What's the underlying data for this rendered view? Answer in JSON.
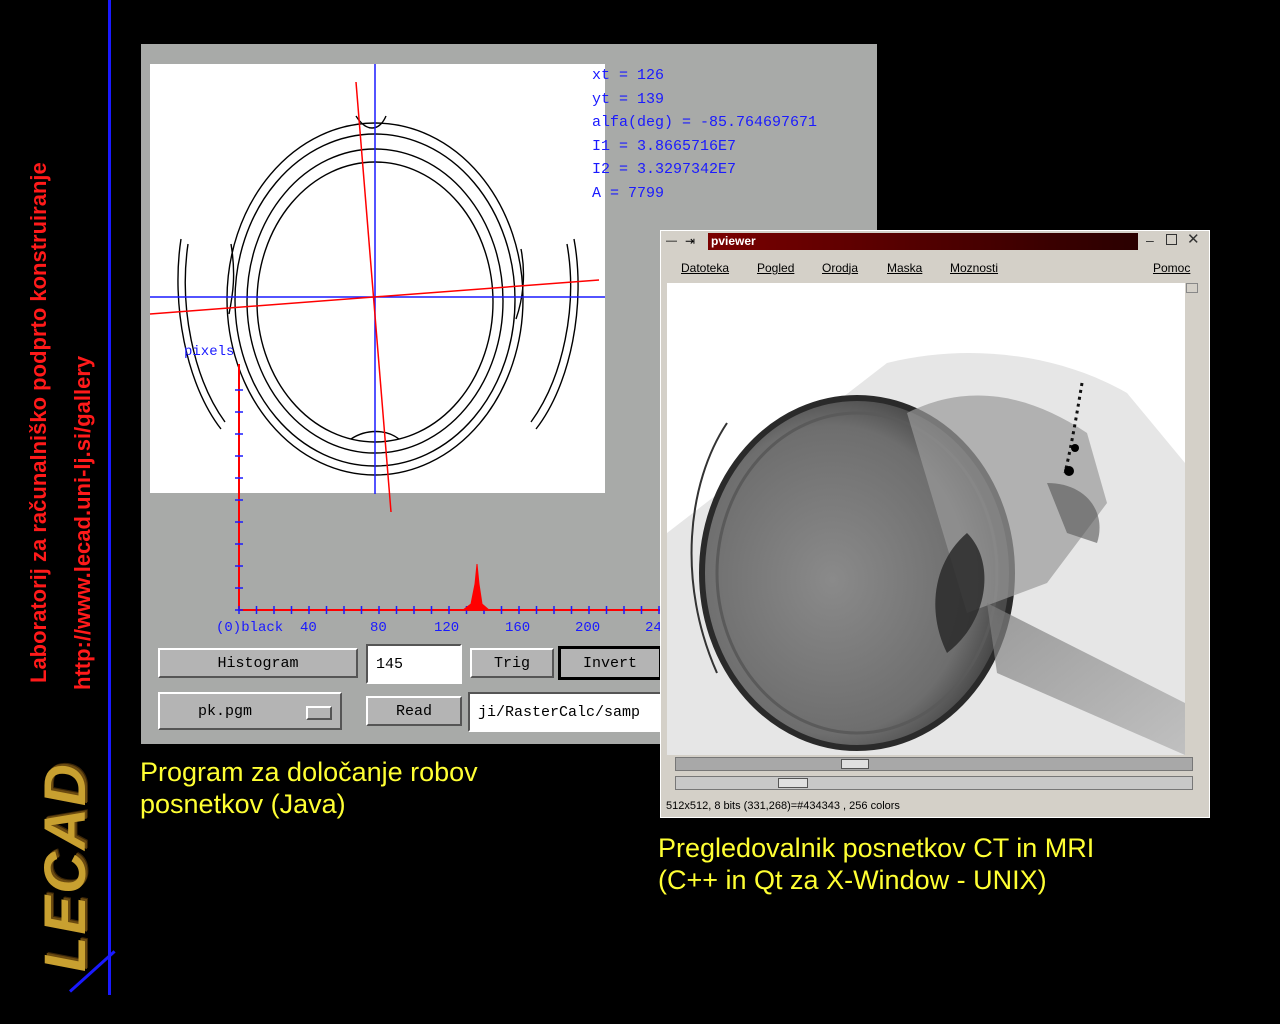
{
  "branding": {
    "lab_name": "Laboratorij za računalniško podprto konstruiranje",
    "url": "http://www.lecad.uni-lj.si/gallery",
    "logo_text": "LECAD"
  },
  "java_app": {
    "readout": {
      "xt": "xt = 126",
      "yt": "yt = 139",
      "alfa": "alfa(deg) = -85.764697671",
      "i1": "I1 = 3.8665716E7",
      "i2": "I2 = 3.3297342E7",
      "a": "A = 7799"
    },
    "pixels_label": "pixels",
    "histogram": {
      "x_ticks": [
        "(0)black",
        "40",
        "80",
        "120",
        "160",
        "200",
        "24"
      ]
    },
    "buttons": {
      "histogram": "Histogram",
      "trig": "Trig",
      "invert": "Invert",
      "read": "Read"
    },
    "threshold_value": "145",
    "file_select": "pk.pgm",
    "path_value": "ji/RasterCalc/samp",
    "caption_line1": "Program za določanje robov",
    "caption_line2": "posnetkov (Java)"
  },
  "viewer": {
    "title": "pviewer",
    "menu": [
      "Datoteka",
      "Pogled",
      "Orodja",
      "Maska",
      "Moznosti"
    ],
    "help_menu": "Pomoc",
    "status": "512x512, 8 bits (331,268)=#434343 , 256 colors",
    "caption_line1": "Pregledovalnik posnetkov CT in MRI",
    "caption_line2": "(C++ in Qt za X-Window - UNIX)"
  },
  "colors": {
    "caption": "#ffff33",
    "branding_text": "#ff1a1a",
    "accent_blue": "#1a1aff",
    "logo": "#c8a030",
    "title_bar": "#7a0000"
  }
}
